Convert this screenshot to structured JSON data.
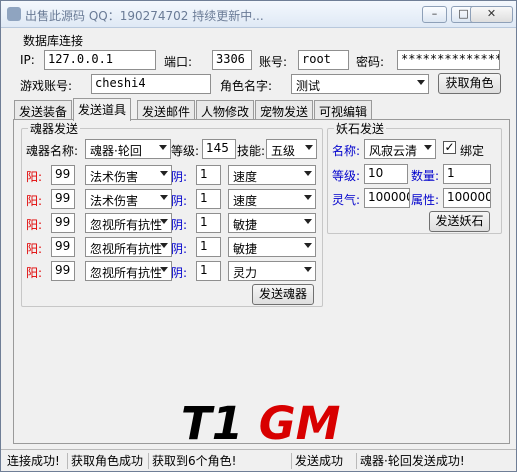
{
  "title": "出售此源码 QQ：190274702 持续更新中...",
  "titlebar": {
    "min": "–",
    "max": "□",
    "close": "✕"
  },
  "database": {
    "group_title": "数据库连接",
    "ip_label": "IP:",
    "ip": "127.0.0.1",
    "port_label": "端口:",
    "port": "3306",
    "account_label": "账号:",
    "account": "root",
    "password_label": "密码:",
    "password": "****************",
    "game_account_label": "游戏账号:",
    "game_account": "cheshi4",
    "role_label": "角色名字:",
    "role": "测试",
    "get_role_btn": "获取角色"
  },
  "tabs": [
    "发送装备",
    "发送道具",
    "发送邮件",
    "人物修改",
    "宠物发送",
    "可视编辑"
  ],
  "soul": {
    "group_title": "魂器发送",
    "name_label": "魂器名称:",
    "name": "魂器·轮回",
    "level_label": "等级:",
    "level": "145",
    "skill_label": "技能:",
    "skill": "五级",
    "rows": [
      {
        "yang_label": "阳:",
        "yang": "99",
        "yang_attr": "法术伤害",
        "yin_label": "阴:",
        "yin": "1",
        "yin_attr": "速度"
      },
      {
        "yang_label": "阳:",
        "yang": "99",
        "yang_attr": "法术伤害",
        "yin_label": "阴:",
        "yin": "1",
        "yin_attr": "速度"
      },
      {
        "yang_label": "阳:",
        "yang": "99",
        "yang_attr": "忽视所有抗性",
        "yin_label": "阴:",
        "yin": "1",
        "yin_attr": "敏捷"
      },
      {
        "yang_label": "阳:",
        "yang": "99",
        "yang_attr": "忽视所有抗性",
        "yin_label": "阴:",
        "yin": "1",
        "yin_attr": "敏捷"
      },
      {
        "yang_label": "阳:",
        "yang": "99",
        "yang_attr": "忽视所有抗性",
        "yin_label": "阴:",
        "yin": "1",
        "yin_attr": "灵力"
      }
    ],
    "send_btn": "发送魂器"
  },
  "demon": {
    "group_title": "妖石发送",
    "name_label": "名称:",
    "name": "风寂云清",
    "bind_label": "绑定",
    "bind_checked": true,
    "level_label": "等级:",
    "level": "10",
    "count_label": "数量:",
    "count": "1",
    "spirit_label": "灵气:",
    "spirit": "100000",
    "attr_label": "属性:",
    "attr": "100000",
    "send_btn": "发送妖石"
  },
  "logo": {
    "t1": "T1",
    "gm": "GM"
  },
  "status": [
    "连接成功!",
    "获取角色成功",
    "获取到6个角色!",
    "发送成功",
    "魂器·轮回发送成功!"
  ]
}
